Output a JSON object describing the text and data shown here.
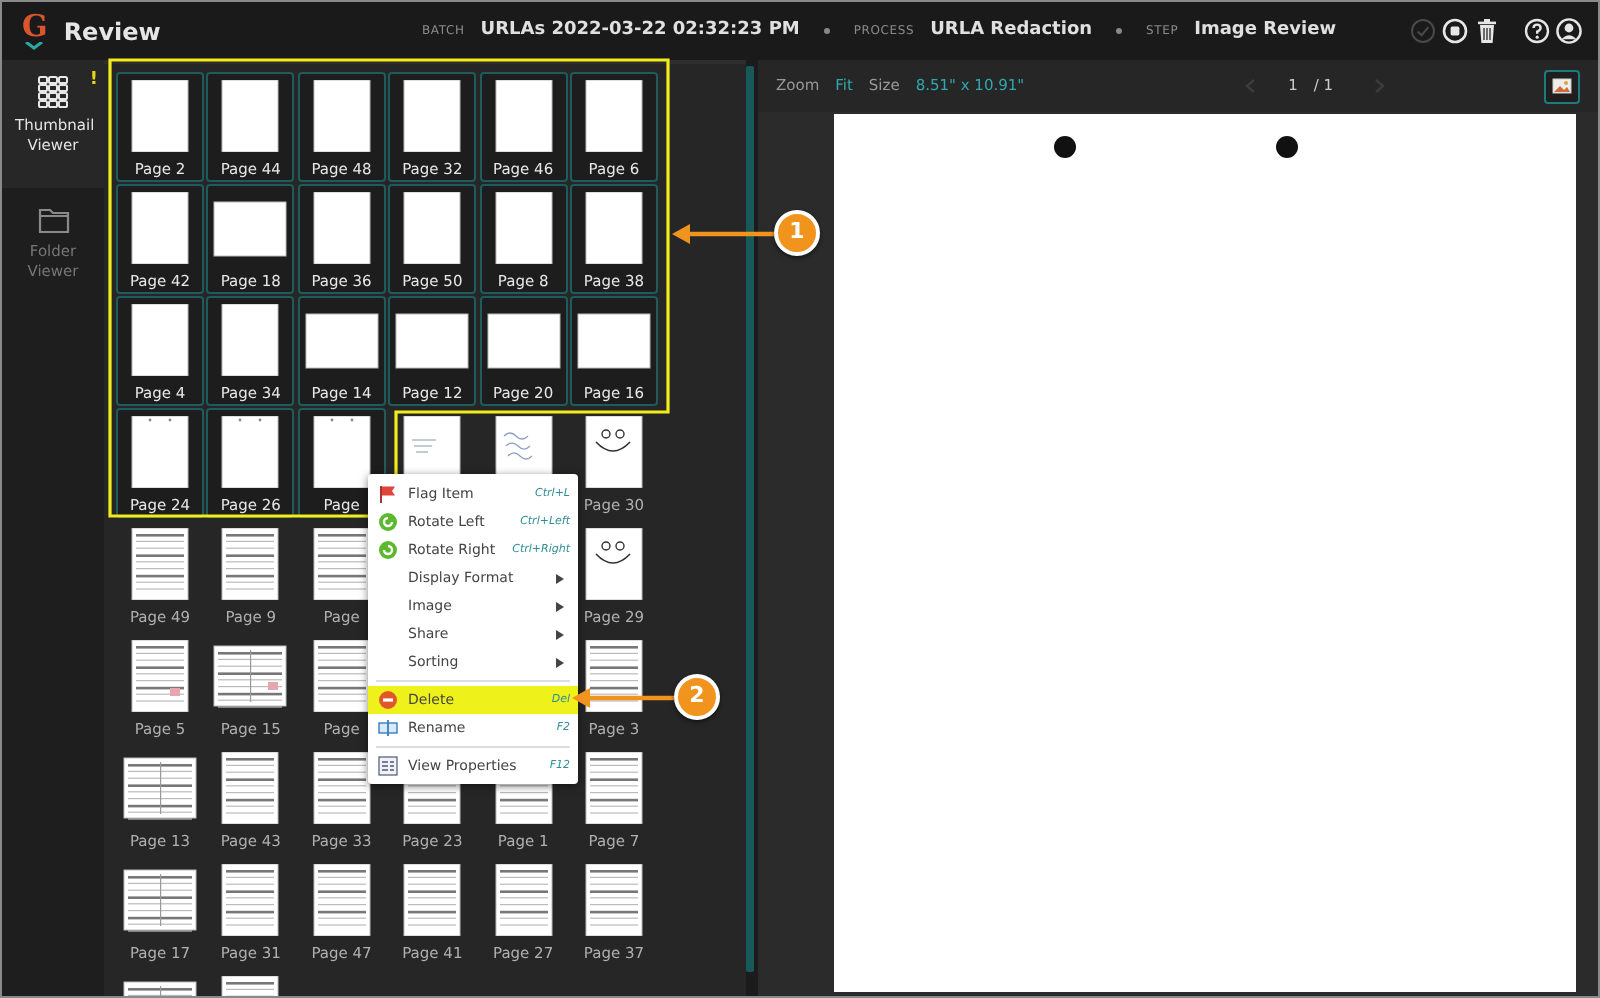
{
  "header": {
    "logo": "G",
    "title": "Review",
    "fields": [
      {
        "label": "BATCH",
        "value": "URLAs 2022-03-22 02:32:23 PM"
      },
      {
        "label": "PROCESS",
        "value": "URLA Redaction"
      },
      {
        "label": "STEP",
        "value": "Image Review"
      }
    ],
    "actions": [
      {
        "kind": "check",
        "disabled": true
      },
      {
        "kind": "stop",
        "disabled": false
      },
      {
        "kind": "trash",
        "disabled": false
      },
      {
        "kind": "help",
        "disabled": false
      },
      {
        "kind": "user",
        "disabled": false
      }
    ]
  },
  "rail": [
    {
      "label": "Thumbnail Viewer",
      "kind": "grid",
      "selected": true,
      "alert": "!"
    },
    {
      "label": "Folder Viewer",
      "kind": "folder",
      "selected": false
    }
  ],
  "thumbnails": [
    {
      "label": "Page 2",
      "kind": "blank",
      "selected": true
    },
    {
      "label": "Page 44",
      "kind": "blank",
      "selected": true
    },
    {
      "label": "Page 48",
      "kind": "blank",
      "selected": true
    },
    {
      "label": "Page 32",
      "kind": "blank",
      "selected": true
    },
    {
      "label": "Page 46",
      "kind": "blank",
      "selected": true
    },
    {
      "label": "Page 6",
      "kind": "blank",
      "selected": true
    },
    {
      "label": "Page 42",
      "kind": "blank",
      "selected": true
    },
    {
      "label": "Page 18",
      "kind": "landscape",
      "selected": true
    },
    {
      "label": "Page 36",
      "kind": "blank",
      "selected": true
    },
    {
      "label": "Page 50",
      "kind": "blank",
      "selected": true
    },
    {
      "label": "Page 8",
      "kind": "blank",
      "selected": true
    },
    {
      "label": "Page 38",
      "kind": "blank",
      "selected": true
    },
    {
      "label": "Page 4",
      "kind": "blank",
      "selected": true
    },
    {
      "label": "Page 34",
      "kind": "blank",
      "selected": true
    },
    {
      "label": "Page 14",
      "kind": "landscape",
      "selected": true
    },
    {
      "label": "Page 12",
      "kind": "landscape",
      "selected": true
    },
    {
      "label": "Page 20",
      "kind": "landscape",
      "selected": true
    },
    {
      "label": "Page 16",
      "kind": "landscape",
      "selected": true
    },
    {
      "label": "Page 24",
      "kind": "marks",
      "selected": true
    },
    {
      "label": "Page 26",
      "kind": "marks",
      "selected": true
    },
    {
      "label": "Page",
      "kind": "marks",
      "selected": true
    },
    {
      "kind": "note",
      "selected": false
    },
    {
      "kind": "handwriting",
      "selected": false
    },
    {
      "label": "Page 30",
      "kind": "smiley",
      "selected": false
    },
    {
      "label": "Page 49",
      "kind": "form",
      "selected": false
    },
    {
      "label": "Page 9",
      "kind": "form",
      "selected": false
    },
    {
      "label": "Page",
      "kind": "form",
      "selected": false
    },
    {
      "kind": "covered"
    },
    {
      "kind": "covered"
    },
    {
      "label": "Page 29",
      "kind": "smiley",
      "selected": false
    },
    {
      "label": "Page 5",
      "kind": "form",
      "selected": false
    },
    {
      "label": "Page 15",
      "kind": "form-wide",
      "selected": false
    },
    {
      "label": "Page",
      "kind": "form",
      "selected": false
    },
    {
      "kind": "covered"
    },
    {
      "kind": "covered"
    },
    {
      "label": "Page 3",
      "kind": "form",
      "selected": false
    },
    {
      "label": "Page 13",
      "kind": "form-wide",
      "selected": false
    },
    {
      "label": "Page 43",
      "kind": "form",
      "selected": false
    },
    {
      "label": "Page 33",
      "kind": "form",
      "selected": false
    },
    {
      "label": "Page 23",
      "kind": "form",
      "selected": false
    },
    {
      "label": "Page 1",
      "kind": "form",
      "selected": false
    },
    {
      "label": "Page 7",
      "kind": "form",
      "selected": false
    },
    {
      "label": "Page 17",
      "kind": "form-wide",
      "selected": false
    },
    {
      "label": "Page 31",
      "kind": "form",
      "selected": false
    },
    {
      "label": "Page 47",
      "kind": "form",
      "selected": false
    },
    {
      "label": "Page 41",
      "kind": "form",
      "selected": false
    },
    {
      "label": "Page 27",
      "kind": "form",
      "selected": false
    },
    {
      "label": "Page 37",
      "kind": "form",
      "selected": false
    },
    {
      "kind": "form-wide",
      "selected": false
    },
    {
      "kind": "form",
      "selected": false
    }
  ],
  "context_menu": [
    {
      "kind": "flag",
      "label": "Flag Item",
      "shortcut": "Ctrl+L",
      "submenu": false,
      "highlighted": false
    },
    {
      "kind": "rotate-left",
      "label": "Rotate Left",
      "shortcut": "Ctrl+Left",
      "submenu": false,
      "highlighted": false
    },
    {
      "kind": "rotate-right",
      "label": "Rotate Right",
      "shortcut": "Ctrl+Right",
      "submenu": false,
      "highlighted": false
    },
    {
      "kind": "plain",
      "label": "Display Format",
      "submenu": true,
      "highlighted": false
    },
    {
      "kind": "plain",
      "label": "Image",
      "submenu": true,
      "highlighted": false
    },
    {
      "kind": "plain",
      "label": "Share",
      "submenu": true,
      "highlighted": false
    },
    {
      "kind": "plain",
      "label": "Sorting",
      "submenu": true,
      "highlighted": false
    },
    {
      "kind": "divider"
    },
    {
      "kind": "delete",
      "label": "Delete",
      "shortcut": "Del",
      "submenu": false,
      "highlighted": true
    },
    {
      "kind": "rename",
      "label": "Rename",
      "shortcut": "F2",
      "submenu": false,
      "highlighted": false
    },
    {
      "kind": "divider"
    },
    {
      "kind": "properties",
      "label": "View Properties",
      "shortcut": "F12",
      "submenu": false,
      "highlighted": false
    }
  ],
  "viewer": {
    "zoom_label": "Zoom",
    "zoom": "Fit",
    "size_label": "Size",
    "size": "8.51\" x 10.91\"",
    "page": "1",
    "page_total": "/ 1"
  },
  "callouts": [
    {
      "label": "1"
    },
    {
      "label": "2"
    }
  ]
}
